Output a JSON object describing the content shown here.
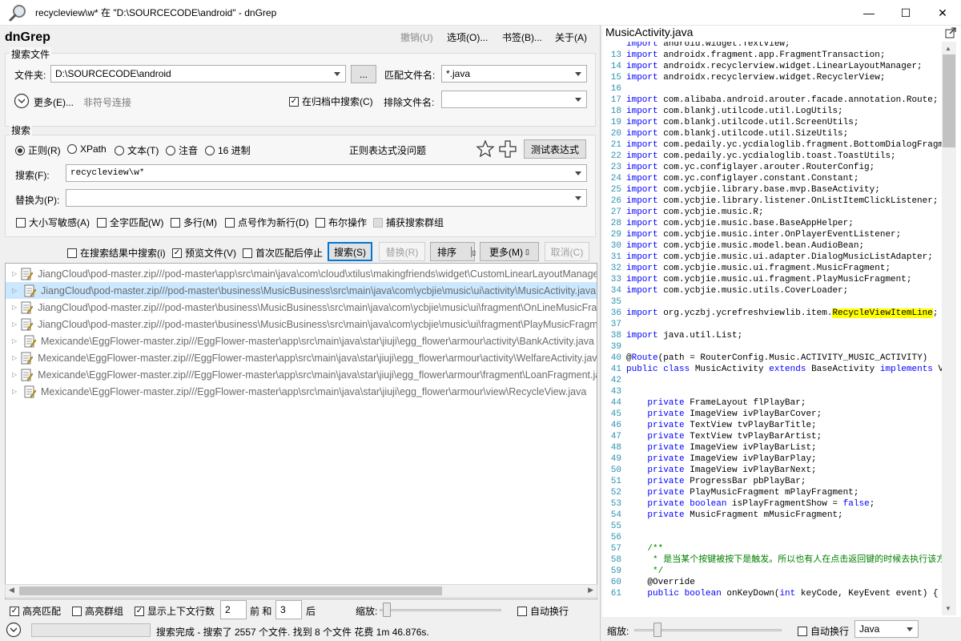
{
  "window": {
    "title": "recycleview\\w* 在 \"D:\\SOURCECODE\\android\" - dnGrep",
    "app_name": "dnGrep",
    "icon": "magnifier-icon",
    "min_glyph": "—",
    "max_glyph": "☐",
    "close_glyph": "✕"
  },
  "menu": {
    "undo": "撤销(U)",
    "options": "选项(O)...",
    "bookmarks": "书签(B)...",
    "about": "关于(A)"
  },
  "search_files": {
    "group_title": "搜索文件",
    "folder_label": "文件夹:",
    "folder_value": "D:\\SOURCECODE\\android",
    "browse_label": "...",
    "match_label": "匹配文件名:",
    "match_value": "*.java",
    "more_label": "更多(E)...",
    "symlink_label": "非符号连接",
    "archive_label": "在归档中搜索(C)",
    "archive_checked": true,
    "exclude_label": "排除文件名:",
    "exclude_value": ""
  },
  "search": {
    "group_title": "搜索",
    "radios": [
      {
        "label": "正则(R)",
        "checked": true
      },
      {
        "label": "XPath",
        "checked": false
      },
      {
        "label": "文本(T)",
        "checked": false
      },
      {
        "label": "注音",
        "checked": false
      },
      {
        "label": "16 进制",
        "checked": false
      }
    ],
    "regex_status": "正则表达式没问题",
    "test_label": "测试表达式",
    "search_label": "搜索(F):",
    "search_value": "recycleview\\w*",
    "replace_label": "替换为(P):",
    "replace_value": "",
    "options": [
      {
        "label": "大小写敏感(A)",
        "checked": false
      },
      {
        "label": "全字匹配(W)",
        "checked": false
      },
      {
        "label": "多行(M)",
        "checked": false
      },
      {
        "label": "点号作为新行(D)",
        "checked": false
      },
      {
        "label": "布尔操作",
        "checked": false
      },
      {
        "label": "捕获搜索群组",
        "checked": false,
        "disabled": true
      }
    ]
  },
  "actions": {
    "in_results": "在搜索结果中搜索(i)",
    "in_results_checked": false,
    "preview": "预览文件(V)",
    "preview_checked": true,
    "stop_first": "首次匹配后停止",
    "stop_first_checked": false,
    "search_btn": "搜索(S)",
    "replace_btn": "替换(R)",
    "sort_btn": "排序",
    "more_btn": "更多(M)",
    "cancel_btn": "取消(C)"
  },
  "results": [
    {
      "path": "JiangCloud\\pod-master.zip///pod-master\\app\\src\\main\\java\\com\\cloud\\xtilus\\makingfriends\\widget\\CustomLinearLayoutManager.java",
      "selected": false
    },
    {
      "path": "JiangCloud\\pod-master.zip///pod-master\\business\\MusicBusiness\\src\\main\\java\\com\\ycbjie\\music\\ui\\activity\\MusicActivity.java",
      "selected": true
    },
    {
      "path": "JiangCloud\\pod-master.zip///pod-master\\business\\MusicBusiness\\src\\main\\java\\com\\ycbjie\\music\\ui\\fragment\\OnLineMusicFragment.java",
      "selected": false
    },
    {
      "path": "JiangCloud\\pod-master.zip///pod-master\\business\\MusicBusiness\\src\\main\\java\\com\\ycbjie\\music\\ui\\fragment\\PlayMusicFragment.java",
      "selected": false
    },
    {
      "path": "Mexicande\\EggFlower-master.zip///EggFlower-master\\app\\src\\main\\java\\star\\jiuji\\egg_flower\\armour\\activity\\BankActivity.java",
      "selected": false
    },
    {
      "path": "Mexicande\\EggFlower-master.zip///EggFlower-master\\app\\src\\main\\java\\star\\jiuji\\egg_flower\\armour\\activity\\WelfareActivity.java",
      "selected": false
    },
    {
      "path": "Mexicande\\EggFlower-master.zip///EggFlower-master\\app\\src\\main\\java\\star\\jiuji\\egg_flower\\armour\\fragment\\LoanFragment.java",
      "selected": false
    },
    {
      "path": "Mexicande\\EggFlower-master.zip///EggFlower-master\\app\\src\\main\\java\\star\\jiuji\\egg_flower\\armour\\view\\RecycleView.java",
      "selected": false
    }
  ],
  "bottom": {
    "highlight_matches": "高亮匹配",
    "highlight_matches_checked": true,
    "highlight_groups": "高亮群组",
    "highlight_groups_checked": false,
    "show_context": "显示上下文行数",
    "show_context_checked": true,
    "before_value": "2",
    "before_label": "前 和",
    "after_value": "3",
    "after_label": "后",
    "zoom_label": "缩放:",
    "wrap_label": "自动换行",
    "wrap_checked": false,
    "status": "搜索完成 - 搜索了 2557 个文件. 找到 8 个文件 花费 1m 46.876s."
  },
  "preview": {
    "filename": "MusicActivity.java",
    "zoom_label": "缩放:",
    "wrap_label": "自动换行",
    "wrap_checked": false,
    "language": "Java",
    "lines": [
      {
        "n": "",
        "parts": [
          [
            "kw",
            "import"
          ],
          [
            "t",
            " android.widget.TextView;"
          ]
        ]
      },
      {
        "n": "13",
        "parts": [
          [
            "kw",
            "import"
          ],
          [
            "t",
            " androidx.fragment.app.FragmentTransaction;"
          ]
        ]
      },
      {
        "n": "14",
        "parts": [
          [
            "kw",
            "import"
          ],
          [
            "t",
            " androidx.recyclerview.widget.LinearLayoutManager;"
          ]
        ]
      },
      {
        "n": "15",
        "parts": [
          [
            "kw",
            "import"
          ],
          [
            "t",
            " androidx.recyclerview.widget.RecyclerView;"
          ]
        ]
      },
      {
        "n": "16",
        "parts": []
      },
      {
        "n": "17",
        "parts": [
          [
            "kw",
            "import"
          ],
          [
            "t",
            " com.alibaba.android.arouter.facade.annotation.Route;"
          ]
        ]
      },
      {
        "n": "18",
        "parts": [
          [
            "kw",
            "import"
          ],
          [
            "t",
            " com.blankj.utilcode.util.LogUtils;"
          ]
        ]
      },
      {
        "n": "19",
        "parts": [
          [
            "kw",
            "import"
          ],
          [
            "t",
            " com.blankj.utilcode.util.ScreenUtils;"
          ]
        ]
      },
      {
        "n": "20",
        "parts": [
          [
            "kw",
            "import"
          ],
          [
            "t",
            " com.blankj.utilcode.util.SizeUtils;"
          ]
        ]
      },
      {
        "n": "21",
        "parts": [
          [
            "kw",
            "import"
          ],
          [
            "t",
            " com.pedaily.yc.ycdialoglib.fragment.BottomDialogFragment;"
          ]
        ]
      },
      {
        "n": "22",
        "parts": [
          [
            "kw",
            "import"
          ],
          [
            "t",
            " com.pedaily.yc.ycdialoglib.toast.ToastUtils;"
          ]
        ]
      },
      {
        "n": "23",
        "parts": [
          [
            "kw",
            "import"
          ],
          [
            "t",
            " com.yc.configlayer.arouter.RouterConfig;"
          ]
        ]
      },
      {
        "n": "24",
        "parts": [
          [
            "kw",
            "import"
          ],
          [
            "t",
            " com.yc.configlayer.constant.Constant;"
          ]
        ]
      },
      {
        "n": "25",
        "parts": [
          [
            "kw",
            "import"
          ],
          [
            "t",
            " com.ycbjie.library.base.mvp.BaseActivity;"
          ]
        ]
      },
      {
        "n": "26",
        "parts": [
          [
            "kw",
            "import"
          ],
          [
            "t",
            " com.ycbjie.library.listener.OnListItemClickListener;"
          ]
        ]
      },
      {
        "n": "27",
        "parts": [
          [
            "kw",
            "import"
          ],
          [
            "t",
            " com.ycbjie.music.R;"
          ]
        ]
      },
      {
        "n": "28",
        "parts": [
          [
            "kw",
            "import"
          ],
          [
            "t",
            " com.ycbjie.music.base.BaseAppHelper;"
          ]
        ]
      },
      {
        "n": "29",
        "parts": [
          [
            "kw",
            "import"
          ],
          [
            "t",
            " com.ycbjie.music.inter.OnPlayerEventListener;"
          ]
        ]
      },
      {
        "n": "30",
        "parts": [
          [
            "kw",
            "import"
          ],
          [
            "t",
            " com.ycbjie.music.model.bean.AudioBean;"
          ]
        ]
      },
      {
        "n": "31",
        "parts": [
          [
            "kw",
            "import"
          ],
          [
            "t",
            " com.ycbjie.music.ui.adapter.DialogMusicListAdapter;"
          ]
        ]
      },
      {
        "n": "32",
        "parts": [
          [
            "kw",
            "import"
          ],
          [
            "t",
            " com.ycbjie.music.ui.fragment.MusicFragment;"
          ]
        ]
      },
      {
        "n": "33",
        "parts": [
          [
            "kw",
            "import"
          ],
          [
            "t",
            " com.ycbjie.music.ui.fragment.PlayMusicFragment;"
          ]
        ]
      },
      {
        "n": "34",
        "parts": [
          [
            "kw",
            "import"
          ],
          [
            "t",
            " com.ycbjie.music.utils.CoverLoader;"
          ]
        ]
      },
      {
        "n": "35",
        "parts": []
      },
      {
        "n": "36",
        "parts": [
          [
            "kw",
            "import"
          ],
          [
            "t",
            " org.yczbj.ycrefreshviewlib.item."
          ],
          [
            "hl",
            "RecycleViewItemLine"
          ],
          [
            "t",
            ";"
          ]
        ]
      },
      {
        "n": "37",
        "parts": []
      },
      {
        "n": "38",
        "parts": [
          [
            "kw",
            "import"
          ],
          [
            "t",
            " java.util.List;"
          ]
        ]
      },
      {
        "n": "39",
        "parts": []
      },
      {
        "n": "40",
        "parts": [
          [
            "t",
            "@"
          ],
          [
            "kw",
            "Route"
          ],
          [
            "t",
            "(path = RouterConfig.Music.ACTIVITY_MUSIC_ACTIVITY)"
          ]
        ]
      },
      {
        "n": "41",
        "parts": [
          [
            "kw",
            "public class"
          ],
          [
            "t",
            " MusicActivity "
          ],
          [
            "kw",
            "extends"
          ],
          [
            "t",
            " BaseActivity "
          ],
          [
            "kw",
            "implements"
          ],
          [
            "t",
            " View.OnClickListener"
          ]
        ]
      },
      {
        "n": "42",
        "parts": []
      },
      {
        "n": "43",
        "parts": []
      },
      {
        "n": "44",
        "parts": [
          [
            "t",
            "    "
          ],
          [
            "kw",
            "private"
          ],
          [
            "t",
            " FrameLayout flPlayBar;"
          ]
        ]
      },
      {
        "n": "45",
        "parts": [
          [
            "t",
            "    "
          ],
          [
            "kw",
            "private"
          ],
          [
            "t",
            " ImageView ivPlayBarCover;"
          ]
        ]
      },
      {
        "n": "46",
        "parts": [
          [
            "t",
            "    "
          ],
          [
            "kw",
            "private"
          ],
          [
            "t",
            " TextView tvPlayBarTitle;"
          ]
        ]
      },
      {
        "n": "47",
        "parts": [
          [
            "t",
            "    "
          ],
          [
            "kw",
            "private"
          ],
          [
            "t",
            " TextView tvPlayBarArtist;"
          ]
        ]
      },
      {
        "n": "48",
        "parts": [
          [
            "t",
            "    "
          ],
          [
            "kw",
            "private"
          ],
          [
            "t",
            " ImageView ivPlayBarList;"
          ]
        ]
      },
      {
        "n": "49",
        "parts": [
          [
            "t",
            "    "
          ],
          [
            "kw",
            "private"
          ],
          [
            "t",
            " ImageView ivPlayBarPlay;"
          ]
        ]
      },
      {
        "n": "50",
        "parts": [
          [
            "t",
            "    "
          ],
          [
            "kw",
            "private"
          ],
          [
            "t",
            " ImageView ivPlayBarNext;"
          ]
        ]
      },
      {
        "n": "51",
        "parts": [
          [
            "t",
            "    "
          ],
          [
            "kw",
            "private"
          ],
          [
            "t",
            " ProgressBar pbPlayBar;"
          ]
        ]
      },
      {
        "n": "52",
        "parts": [
          [
            "t",
            "    "
          ],
          [
            "kw",
            "private"
          ],
          [
            "t",
            " PlayMusicFragment mPlayFragment;"
          ]
        ]
      },
      {
        "n": "53",
        "parts": [
          [
            "t",
            "    "
          ],
          [
            "kw",
            "private boolean"
          ],
          [
            "t",
            " isPlayFragmentShow = "
          ],
          [
            "kw",
            "false"
          ],
          [
            "t",
            ";"
          ]
        ]
      },
      {
        "n": "54",
        "parts": [
          [
            "t",
            "    "
          ],
          [
            "kw",
            "private"
          ],
          [
            "t",
            " MusicFragment mMusicFragment;"
          ]
        ]
      },
      {
        "n": "55",
        "parts": []
      },
      {
        "n": "56",
        "parts": []
      },
      {
        "n": "57",
        "parts": [
          [
            "cm",
            "    /**"
          ]
        ]
      },
      {
        "n": "58",
        "parts": [
          [
            "cm",
            "     * 是当某个按键被按下是触发。所以也有人在点击返回键的时候去执行该方法来做判断"
          ]
        ]
      },
      {
        "n": "59",
        "parts": [
          [
            "cm",
            "     */"
          ]
        ]
      },
      {
        "n": "60",
        "parts": [
          [
            "t",
            "    @Override"
          ]
        ]
      },
      {
        "n": "61",
        "parts": [
          [
            "t",
            "    "
          ],
          [
            "kw",
            "public boolean"
          ],
          [
            "t",
            " onKeyDown("
          ],
          [
            "kw",
            "int"
          ],
          [
            "t",
            " keyCode, KeyEvent event) {"
          ]
        ]
      }
    ]
  }
}
